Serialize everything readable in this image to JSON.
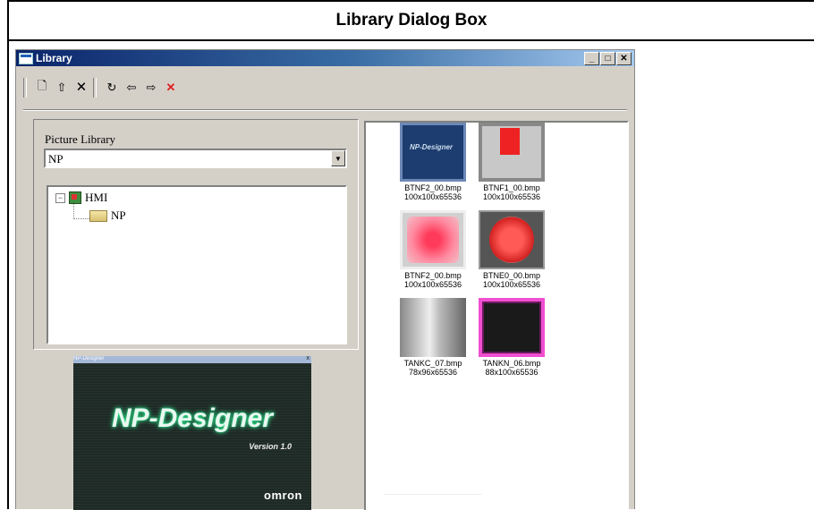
{
  "header": {
    "title": "Library Dialog Box"
  },
  "window": {
    "title": "Library",
    "buttons": {
      "minimize": "_",
      "maximize": "□",
      "close": "✕"
    }
  },
  "toolbar": {
    "items": [
      {
        "name": "new-icon",
        "glyph": "🗋"
      },
      {
        "name": "rename-icon",
        "glyph": "⇧"
      },
      {
        "name": "delete-icon",
        "glyph": "🗙"
      },
      {
        "name": "refresh-icon",
        "glyph": "↻"
      },
      {
        "name": "import-icon",
        "glyph": "⇦"
      },
      {
        "name": "export-icon",
        "glyph": "⇨"
      },
      {
        "name": "close-x-icon",
        "glyph": "✕",
        "color": "#e02020"
      }
    ]
  },
  "library": {
    "label": "Picture Library",
    "selected": "NP",
    "dropdown_arrow": "▼",
    "tree": [
      {
        "label": "HMI",
        "expander": "−"
      },
      {
        "label": "NP"
      }
    ]
  },
  "splash": {
    "window_title": "NP-Designer",
    "close_glyph": "x",
    "title": "NP-Designer",
    "version": "Version 1.0",
    "brand": "omron"
  },
  "thumbnails": [
    {
      "name": "BTNF2_00.bmp",
      "size": "100x100x65536",
      "style": "np",
      "caption": "NP-Designer"
    },
    {
      "name": "BTNF1_00.bmp",
      "size": "100x100x65536",
      "style": "red"
    },
    {
      "name": "BTNF2_00.bmp",
      "size": "100x100x65536",
      "style": "pink"
    },
    {
      "name": "BTNE0_00.bmp",
      "size": "100x100x65536",
      "style": "circle"
    },
    {
      "name": "TANKC_07.bmp",
      "size": "78x96x65536",
      "style": "tankc"
    },
    {
      "name": "TANKN_06.bmp",
      "size": "88x100x65536",
      "style": "tankn"
    }
  ]
}
